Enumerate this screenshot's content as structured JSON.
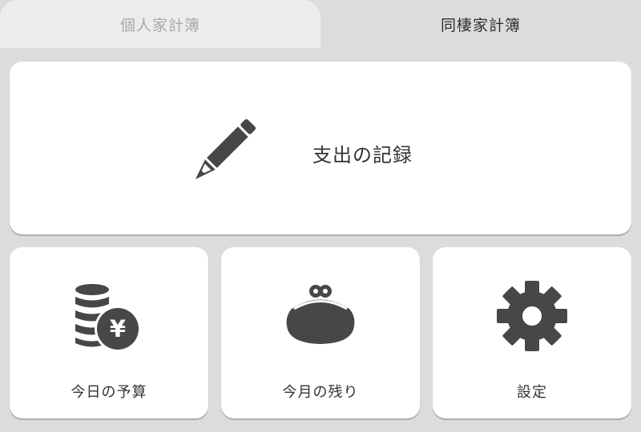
{
  "tabs": [
    {
      "label": "個人家計簿",
      "active": false
    },
    {
      "label": "同棲家計簿",
      "active": true
    }
  ],
  "main_action": {
    "label": "支出の記録",
    "icon": "pencil-icon"
  },
  "cards": [
    {
      "label": "今日の予算",
      "icon": "coins-yen-icon"
    },
    {
      "label": "今月の残り",
      "icon": "coin-purse-icon"
    },
    {
      "label": "設定",
      "icon": "gear-icon"
    }
  ],
  "currency_symbol": "¥",
  "colors": {
    "background": "#dcdcdc",
    "card": "#ffffff",
    "icon": "#474747",
    "text": "#333333",
    "tab_inactive_text": "#a9a9a9"
  }
}
